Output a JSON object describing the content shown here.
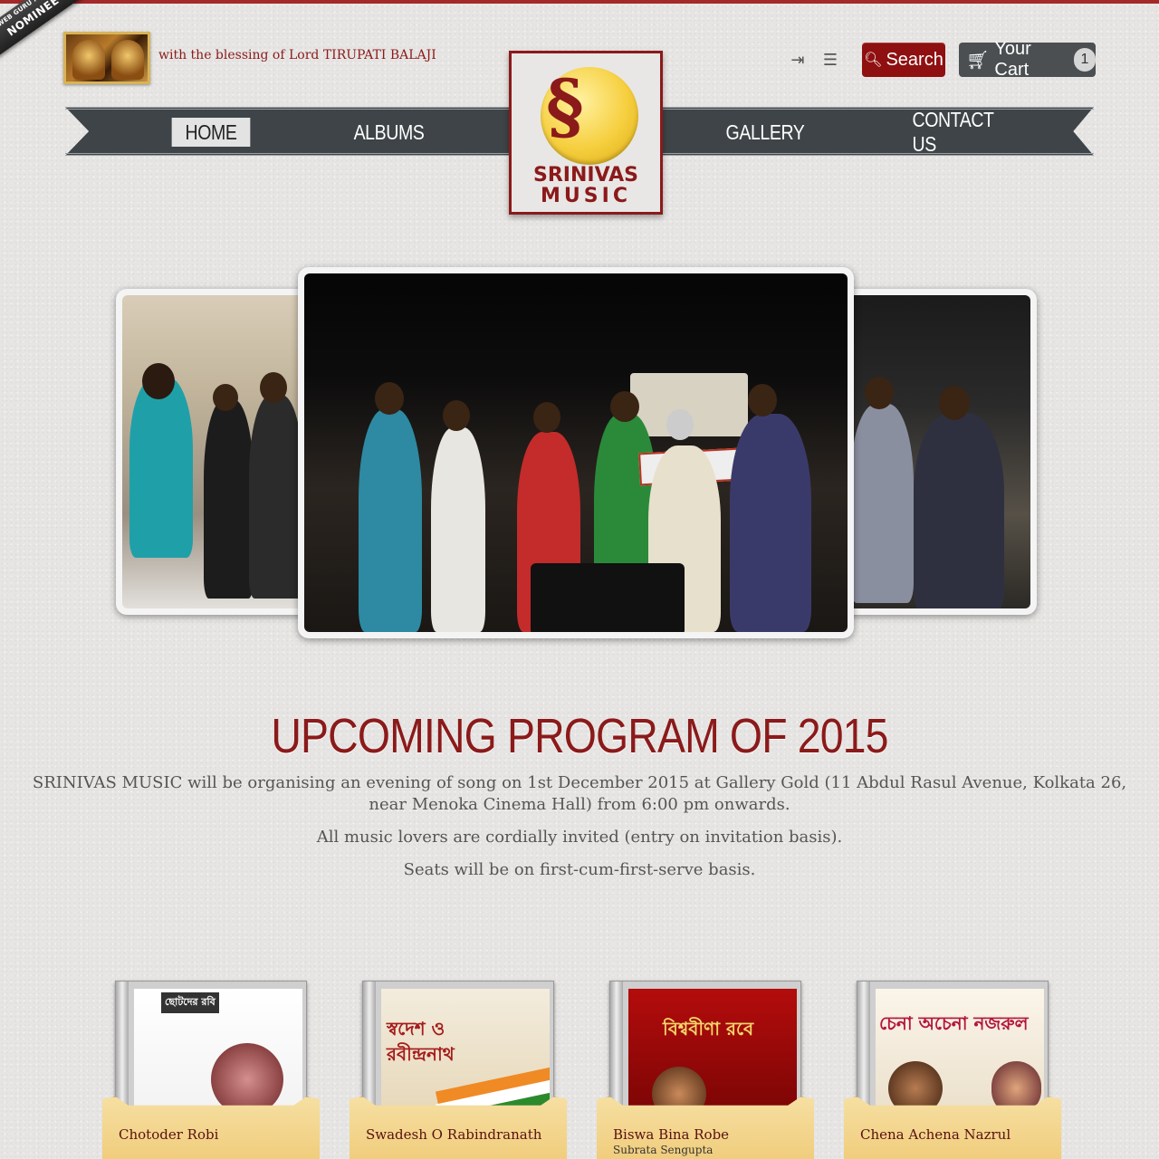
{
  "header": {
    "award": {
      "line1": "WEB GURU AWARDS",
      "line2": "NOMINEE"
    },
    "blessing": "with the blessing of Lord TIRUPATI BALAJI",
    "search_label": "Search",
    "cart_label": "Your Cart",
    "cart_count": "1",
    "icons": [
      "login-icon",
      "register-icon",
      "search-icon",
      "cart-icon"
    ]
  },
  "nav": {
    "items": [
      {
        "label": "HOME",
        "active": true
      },
      {
        "label": "ALBUMS"
      },
      {
        "label": "GALLERY"
      },
      {
        "label": "CONTACT US"
      }
    ]
  },
  "logo": {
    "line1": "SRINIVAS",
    "line2": "MUSIC"
  },
  "program": {
    "title": "UPCOMING PROGRAM OF 2015",
    "p1a": "SRINIVAS MUSIC will be organising an evening of song on 1st December 2015 at Gallery Gold (11 Abdul Rasul Avenue, Kolkata 26,",
    "p1b": "near Menoka Cinema Hall) from 6:00 pm onwards.",
    "p2": "All music lovers are cordially invited (entry on invitation basis).",
    "p3": "Seats will be on first-cum-first-serve basis."
  },
  "albums": [
    {
      "name": "Chotoder Robi",
      "artist": "",
      "cover_text": "ছোটদের রবি"
    },
    {
      "name": "Swadesh O Rabindranath",
      "artist": "",
      "cover_text": "স্বদেশ ও রবীন্দ্রনাথ"
    },
    {
      "name": "Biswa Bina Robe",
      "artist": "Subrata Sengupta",
      "cover_text": "বিশ্ববীণা রবে"
    },
    {
      "name": "Chena Achena Nazrul",
      "artist": "",
      "cover_text": "চেনা অচেনা নজরুল"
    }
  ],
  "colors": {
    "brand": "#8b1a1a",
    "nav": "#3e4447",
    "pocket": "#f0cd7c"
  }
}
